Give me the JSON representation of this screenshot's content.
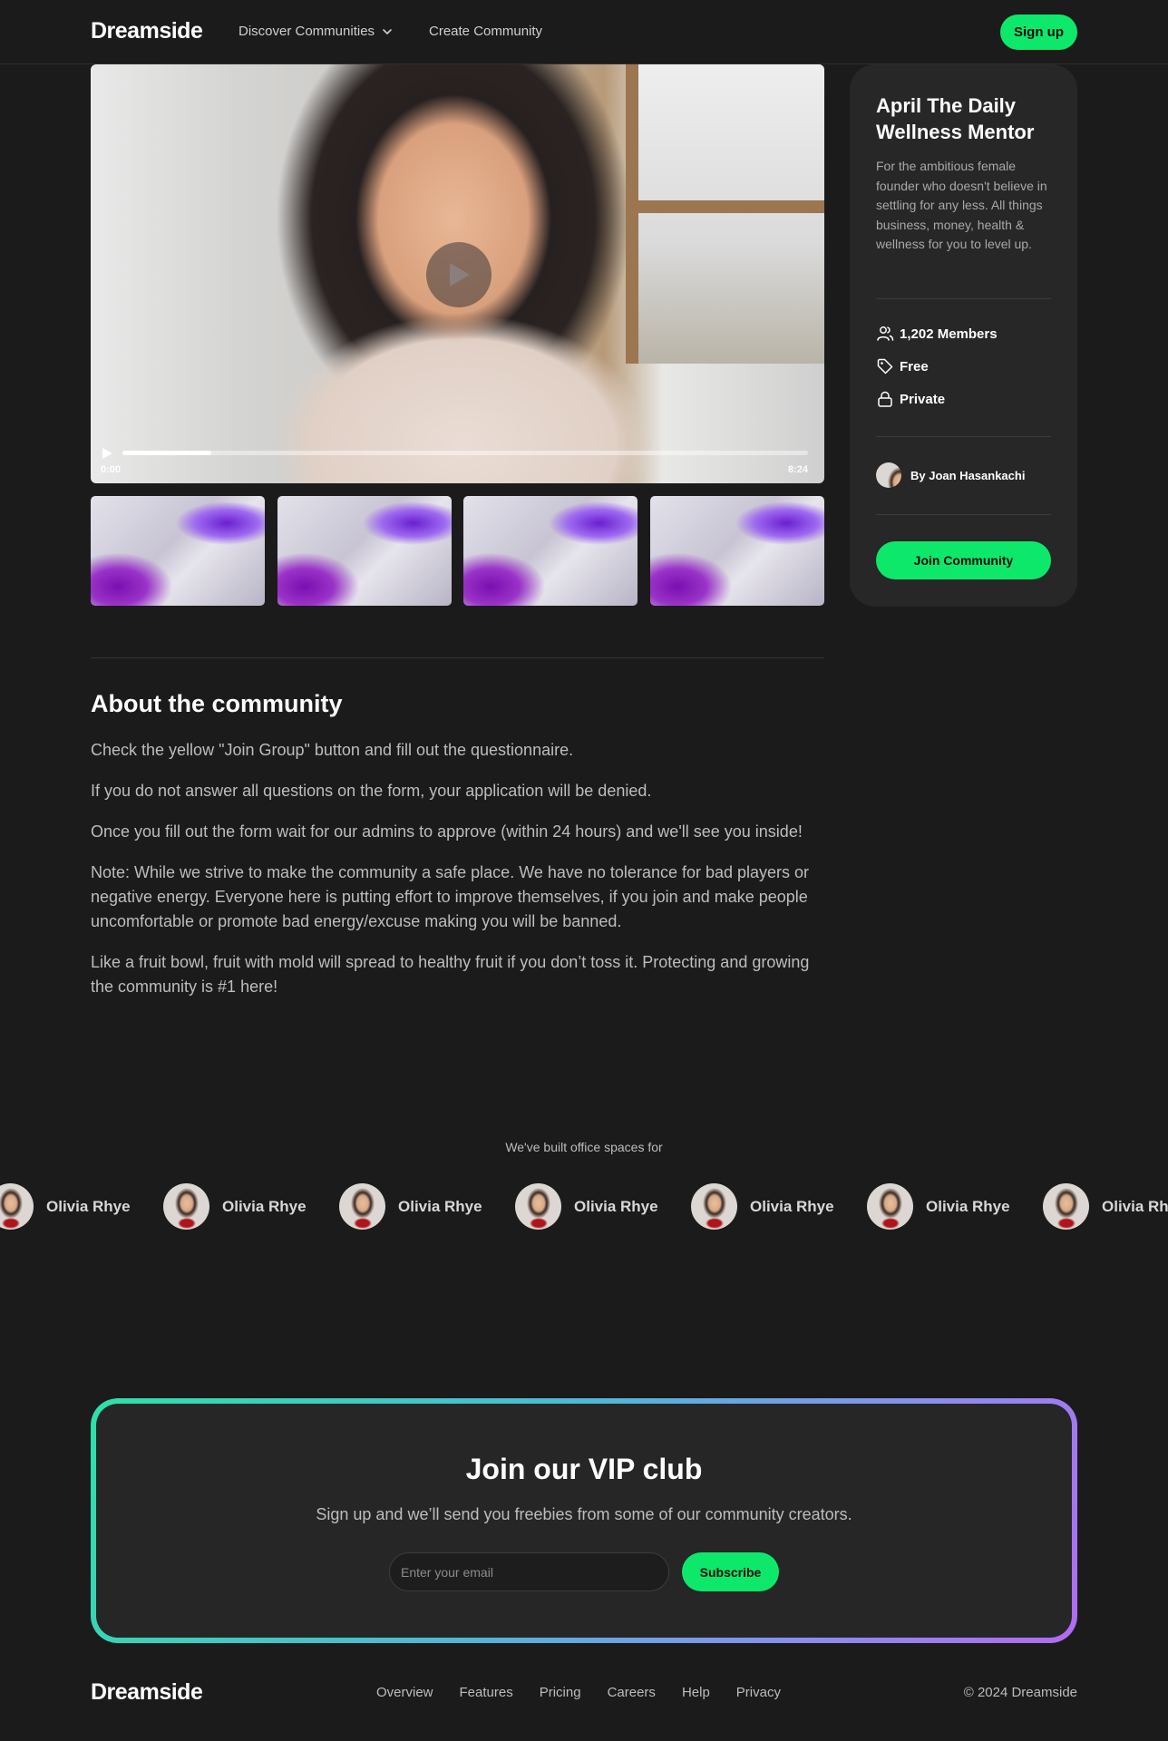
{
  "header": {
    "logo": "Dreamside",
    "nav": [
      {
        "label": "Discover Communities",
        "has_dropdown": true
      },
      {
        "label": "Create Community",
        "has_dropdown": false
      }
    ],
    "signup_label": "Sign up"
  },
  "video": {
    "current_time": "0:00",
    "duration": "8:24",
    "progress_fraction": 0.13
  },
  "thumbnails_count": 4,
  "community": {
    "title": "April The Daily Wellness Mentor",
    "description": "For the ambitious female founder who doesn't believe in settling for any less. All things business, money, health & wellness for you to level up.",
    "members": "1,202 Members",
    "price": "Free",
    "privacy": "Private",
    "author": "By Joan Hasankachi",
    "join_label": "Join Community"
  },
  "about": {
    "title": "About the community",
    "paragraphs": [
      "Check the yellow \"Join Group\" button and fill out the questionnaire.",
      "If you do not answer all questions on the form, your application will be denied.",
      "Once you fill out the form wait for our admins to approve (within 24 hours) and we'll see you inside!",
      "Note: While we strive to make the community a safe place. We have no tolerance for bad players or negative energy. Everyone here is putting effort to improve themselves, if you join and make people uncomfortable or promote bad energy/excuse making you will be banned.",
      "Like a fruit bowl, fruit with mold will spread to healthy fruit if you don’t toss it. Protecting and growing the community is #1 here!"
    ]
  },
  "built_for": {
    "label": "We've built office spaces for",
    "people": [
      "Olivia Rhye",
      "Olivia Rhye",
      "Olivia Rhye",
      "Olivia Rhye",
      "Olivia Rhye",
      "Olivia Rhye",
      "Olivia Rhye"
    ]
  },
  "vip": {
    "title": "Join our VIP club",
    "subtitle": "Sign up and we’ll send you freebies from some of our community creators.",
    "email_placeholder": "Enter your email",
    "subscribe_label": "Subscribe"
  },
  "footer": {
    "logo": "Dreamside",
    "links": [
      "Overview",
      "Features",
      "Pricing",
      "Careers",
      "Help",
      "Privacy"
    ],
    "copyright": "© 2024 Dreamside"
  },
  "colors": {
    "background": "#1b1b1b",
    "card": "#272727",
    "accent": "#0ee86a",
    "gradient": [
      "#2ee0a8",
      "#4fb8d8",
      "#b26af2"
    ]
  }
}
